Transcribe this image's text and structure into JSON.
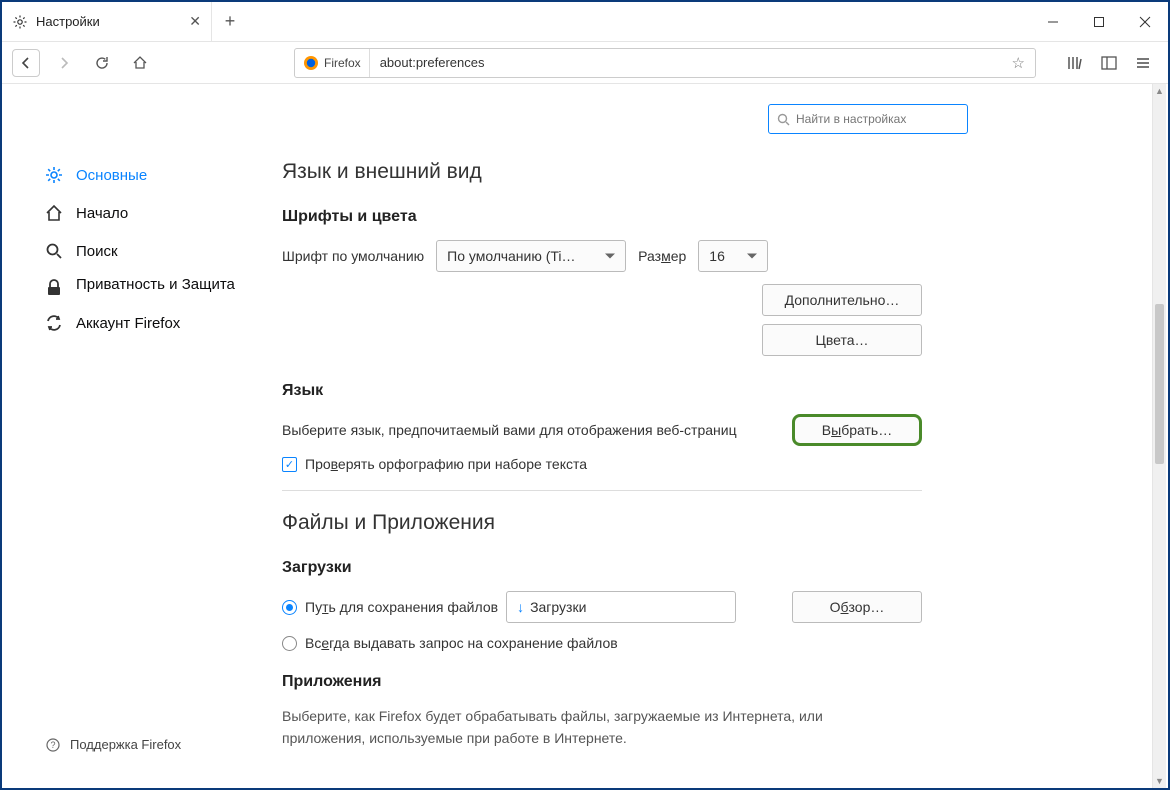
{
  "window": {
    "tab_title": "Настройки",
    "url_label": "Firefox",
    "url": "about:preferences"
  },
  "search": {
    "placeholder": "Найти в настройках"
  },
  "sidebar": {
    "items": [
      {
        "label": "Основные"
      },
      {
        "label": "Начало"
      },
      {
        "label": "Поиск"
      },
      {
        "label": "Приватность и Защита"
      },
      {
        "label": "Аккаунт Firefox"
      }
    ],
    "support": "Поддержка Firefox"
  },
  "section_lang": {
    "title": "Язык и внешний вид",
    "fonts_heading": "Шрифты и цвета",
    "default_font_label": "Шрифт по умолчанию",
    "default_font_value": "По умолчанию (Ti…",
    "size_label": "Размер",
    "size_value": "16",
    "advanced_btn": "Дополнительно…",
    "colors_btn": "Цвета…",
    "lang_heading": "Язык",
    "lang_desc": "Выберите язык, предпочитаемый вами для отображения веб-страниц",
    "choose_btn": "Выбрать…",
    "spellcheck": "Проверять орфографию при наборе текста"
  },
  "section_files": {
    "title": "Файлы и Приложения",
    "downloads_heading": "Загрузки",
    "radio_save": "Путь для сохранения файлов",
    "save_path": "Загрузки",
    "browse_btn": "Обзор…",
    "radio_ask": "Всегда выдавать запрос на сохранение файлов",
    "apps_heading": "Приложения",
    "apps_desc": "Выберите, как Firefox будет обрабатывать файлы, загружаемые из Интернета, или приложения, используемые при работе в Интернете."
  }
}
